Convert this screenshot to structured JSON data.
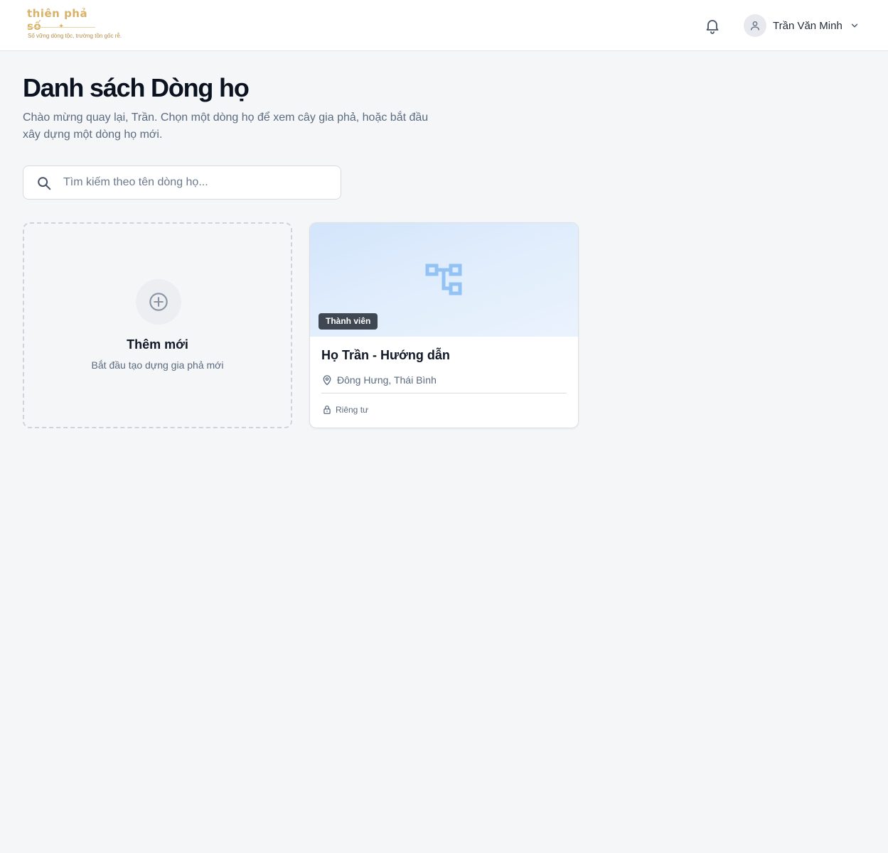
{
  "header": {
    "logo": {
      "title": "thiên phả số",
      "tagline": "Số vững dòng tộc, trường tồn gốc rễ."
    },
    "notification_icon": "bell-icon",
    "user": {
      "name": "Trần Văn Minh",
      "avatar_icon": "user-icon",
      "menu_icon": "chevron-down-icon"
    }
  },
  "main": {
    "title": "Danh sách Dòng họ",
    "subtitle": "Chào mừng quay lại, Trần. Chọn một dòng họ để xem cây gia phả, hoặc bắt đầu xây dựng một dòng họ mới.",
    "search": {
      "placeholder": "Tìm kiếm theo tên dòng họ...",
      "value": "",
      "icon": "search-icon"
    },
    "add_card": {
      "icon": "plus-circle-icon",
      "title": "Thêm mới",
      "subtitle": "Bắt đầu tạo dựng gia phả mới"
    },
    "clans": [
      {
        "badge": "Thành viên",
        "name": "Họ Trần - Hướng dẫn",
        "location": "Đông Hưng, Thái Bình",
        "privacy": "Riêng tư",
        "cover_icon": "family-tree-icon"
      }
    ]
  },
  "colors": {
    "accent_logo": "#d9b26a",
    "badge_bg": "#3f4752",
    "tree_icon": "#93c2f5",
    "page_bg": "#f5f6f8"
  }
}
